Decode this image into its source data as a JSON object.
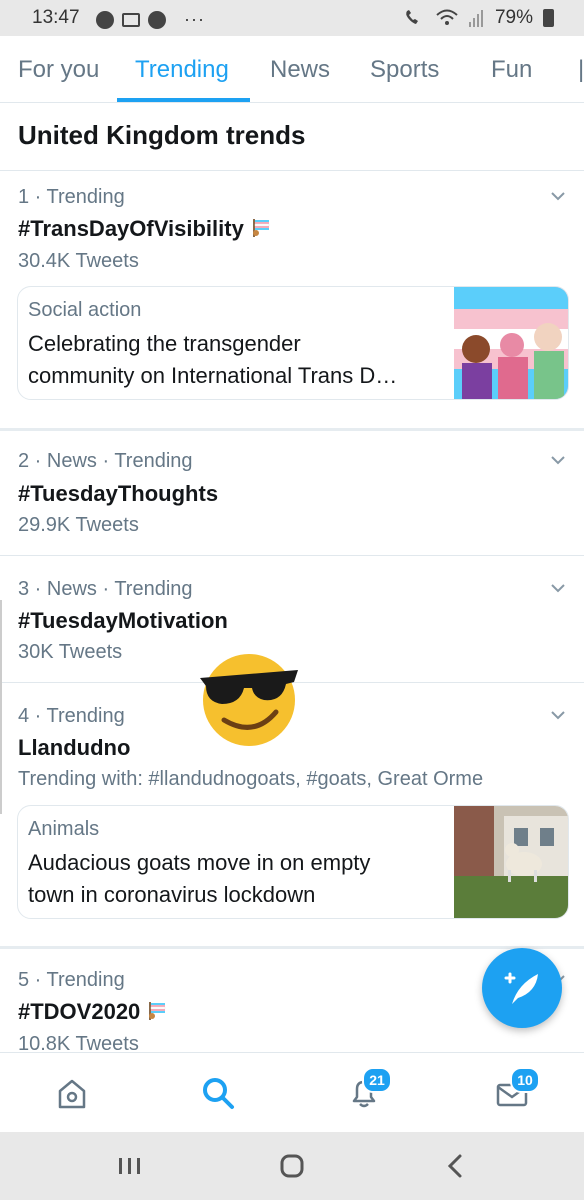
{
  "status_bar": {
    "time": "13:47",
    "battery": "79%"
  },
  "tabs": [
    {
      "label": "For you",
      "active": false
    },
    {
      "label": "Trending",
      "active": true
    },
    {
      "label": "News",
      "active": false
    },
    {
      "label": "Sports",
      "active": false
    },
    {
      "label": "Fun",
      "active": false
    }
  ],
  "section_title": "United Kingdom trends",
  "trends": [
    {
      "meta": "1 · Trending",
      "name": "#TransDayOfVisibility",
      "count": "30.4K Tweets",
      "card": {
        "category": "Social action",
        "line1": "Celebrating the transgender",
        "line2": "community on International Trans D…"
      }
    },
    {
      "meta": "2 · News · Trending",
      "name": "#TuesdayThoughts",
      "count": "29.9K Tweets"
    },
    {
      "meta": "3 · News · Trending",
      "name": "#TuesdayMotivation",
      "count": "30K Tweets"
    },
    {
      "meta": "4 · Trending",
      "name": "Llandudno",
      "count": "Trending with: #llandudnogoats, #goats, Great Orme",
      "card": {
        "category": "Animals",
        "line1": "Audacious goats move in on empty",
        "line2": "town in coronavirus lockdown"
      }
    },
    {
      "meta": "5 · Trending",
      "name": "#TDOV2020",
      "count": "10.8K Tweets"
    }
  ],
  "bottom_nav": {
    "notifications_badge": "21",
    "messages_badge": "10"
  },
  "colors": {
    "accent": "#1da1f2",
    "secondary_text": "#657786",
    "divider": "#e1e8ed"
  }
}
